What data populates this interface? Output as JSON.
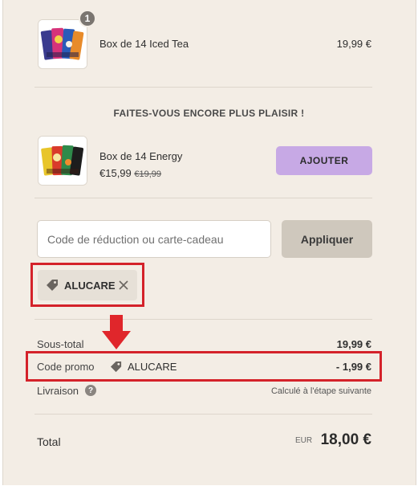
{
  "cart_item": {
    "quantity": "1",
    "name": "Box de 14 Iced Tea",
    "price": "19,99 €"
  },
  "upsell": {
    "heading": "FAITES-VOUS ENCORE PLUS PLAISIR !",
    "product": {
      "name": "Box de 14 Energy",
      "price": "€15,99",
      "old_price": "€19,99"
    },
    "add_label": "AJOUTER"
  },
  "discount": {
    "placeholder": "Code de réduction ou carte-cadeau",
    "value": "",
    "apply_label": "Appliquer",
    "applied_code": "ALUCARE"
  },
  "summary": {
    "subtotal_label": "Sous-total",
    "subtotal_value": "19,99 €",
    "promo_label": "Code promo",
    "promo_code": "ALUCARE",
    "promo_value": "- 1,99 €",
    "shipping_label": "Livraison",
    "shipping_value": "Calculé à l'étape suivante",
    "total_label": "Total",
    "currency": "EUR",
    "total_value": "18,00 €"
  },
  "colors": {
    "background": "#f3ede5",
    "accent_button": "#c7a9e5",
    "apply_button": "#cfc8bd",
    "highlight": "#d4222a"
  }
}
